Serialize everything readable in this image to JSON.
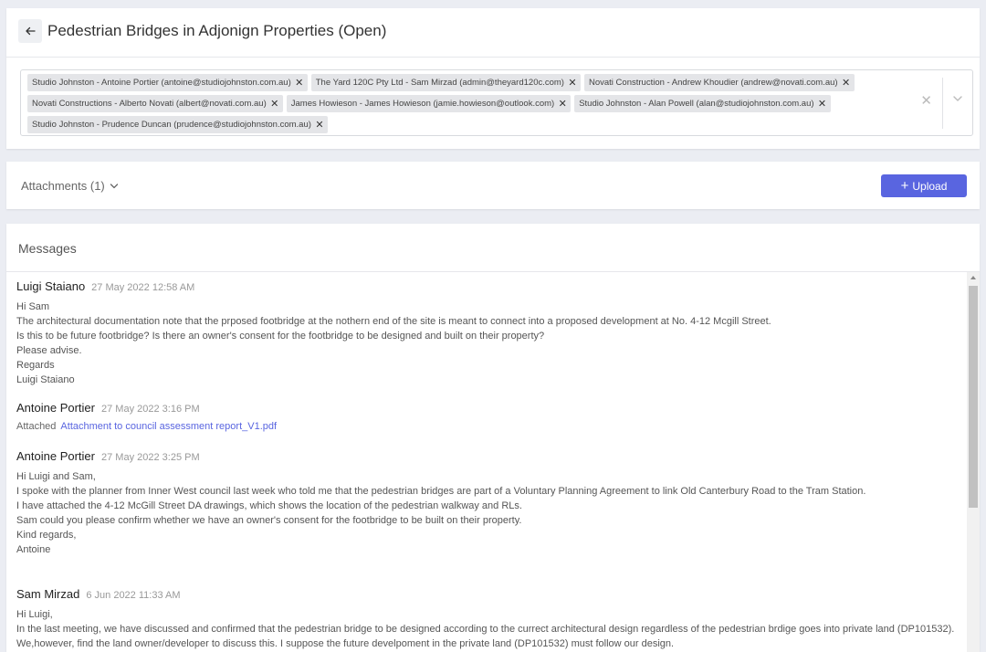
{
  "header": {
    "back_icon": "arrow-left-icon",
    "title": "Pedestrian Bridges in Adjonign Properties (Open)"
  },
  "recipients": [
    {
      "label": "Studio Johnston - Antoine Portier (antoine@studiojohnston.com.au)"
    },
    {
      "label": "The Yard 120C Pty Ltd - Sam Mirzad (admin@theyard120c.com)"
    },
    {
      "label": "Novati Construction - Andrew Khoudier (andrew@novati.com.au)"
    },
    {
      "label": "Novati Constructions - Alberto Novati (albert@novati.com.au)"
    },
    {
      "label": "James Howieson - James Howieson (jamie.howieson@outlook.com)"
    },
    {
      "label": "Studio Johnston - Alan Powell (alan@studiojohnston.com.au)"
    },
    {
      "label": "Studio Johnston - Prudence Duncan (prudence@studiojohnston.com.au)"
    }
  ],
  "remove_glyph": "✕",
  "attachments": {
    "label": "Attachments (1)",
    "upload_label": "Upload",
    "upload_icon": "plus-icon"
  },
  "messages_title": "Messages",
  "messages": [
    {
      "author": "Luigi Staiano",
      "time": "27 May 2022 12:58 AM",
      "lines": [
        "Hi Sam",
        "The architectural documentation note that the prposed footbridge at the nothern end of the site is meant to connect into  a proposed development at No. 4-12 Mcgill Street.",
        "Is this to be future footbridge? Is there an owner's consent for the footbridge to be designed and built on their property?",
        "Please advise.",
        "Regards",
        "Luigi Staiano"
      ]
    },
    {
      "author": "Antoine Portier",
      "time": "27 May 2022 3:16 PM",
      "attached_prefix": "Attached",
      "attachment_name": "Attachment to council assessment report_V1.pdf"
    },
    {
      "author": "Antoine Portier",
      "time": "27 May 2022 3:25 PM",
      "lines": [
        "Hi Luigi and Sam,",
        "I spoke with the planner from Inner West council last week who told me that the pedestrian bridges are part of a Voluntary Planning Agreement to link Old Canterbury Road to the Tram Station.",
        "I have attached the 4-12 McGill Street DA drawings, which shows the location of the pedestrian walkway and RLs.",
        "Sam could you please confirm whether we have an owner's consent for the footbridge to be built on their property.",
        "Kind regards,",
        "Antoine"
      ]
    },
    {
      "author": "Sam Mirzad",
      "time": "6 Jun 2022 11:33 AM",
      "lines": [
        "Hi Luigi,",
        "In the last meeting, we have discussed and confirmed that the pedestrian bridge to be designed according to the currect architectural design regardless of the pedestrian brdige goes into private land (DP101532).",
        "We,however, find the land owner/developer to discuss this. I suppose the future develpoment in the private land (DP101532) must follow our design."
      ]
    }
  ]
}
